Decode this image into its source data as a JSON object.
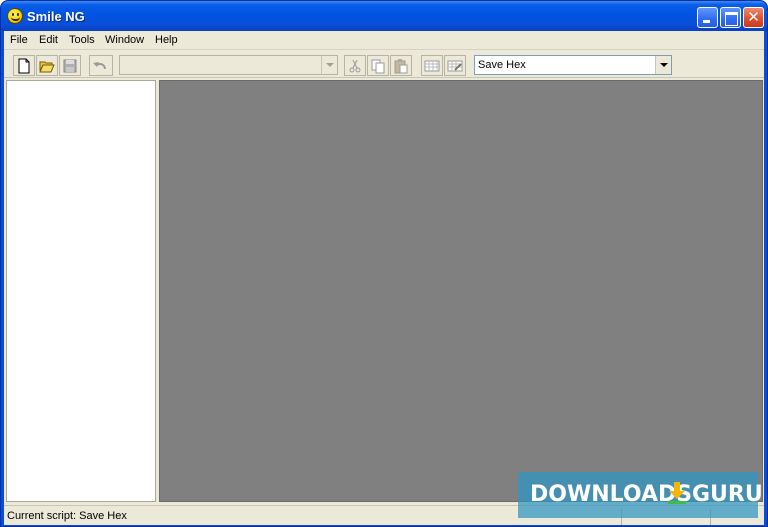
{
  "window": {
    "title": "Smile NG"
  },
  "menu": [
    "File",
    "Edit",
    "Tools",
    "Window",
    "Help"
  ],
  "toolbar": {
    "script_combo_value": "Save Hex",
    "icons": [
      "new-file-icon",
      "open-folder-icon",
      "save-icon",
      "undo-icon",
      "cut-icon",
      "copy-icon",
      "paste-icon",
      "grid-icon",
      "grid-edit-icon"
    ]
  },
  "status": {
    "text": "Current script: Save Hex"
  },
  "watermark": {
    "left": "DOWNLOADS",
    "right": "GURU"
  }
}
